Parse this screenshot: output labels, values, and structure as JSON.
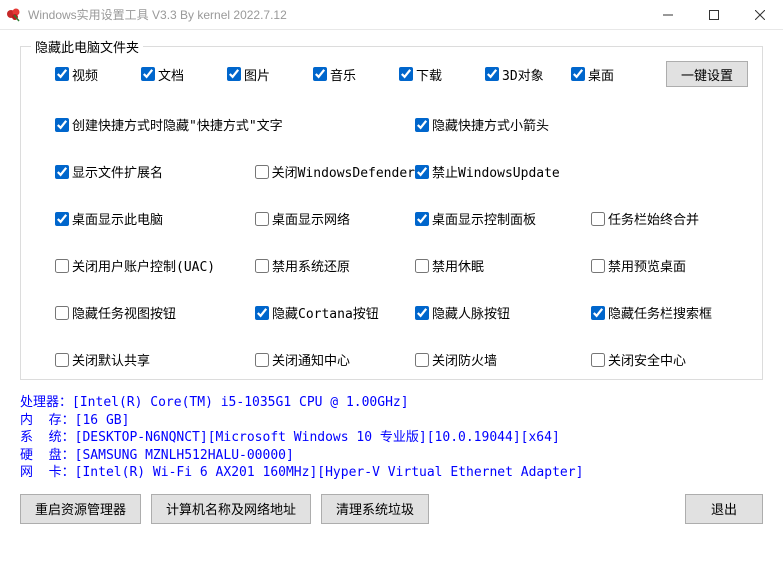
{
  "window": {
    "title": "Windows实用设置工具 V3.3 By kernel 2022.7.12"
  },
  "group": {
    "title": "隐藏此电脑文件夹",
    "folders": [
      {
        "label": "视频",
        "checked": true
      },
      {
        "label": "文档",
        "checked": true
      },
      {
        "label": "图片",
        "checked": true
      },
      {
        "label": "音乐",
        "checked": true
      },
      {
        "label": "下载",
        "checked": true
      },
      {
        "label": "3D对象",
        "checked": true
      },
      {
        "label": "桌面",
        "checked": true
      }
    ],
    "one_key": "一键设置"
  },
  "opts": [
    {
      "label": "创建快捷方式时隐藏\"快捷方式\"文字",
      "checked": true,
      "span": 2
    },
    {
      "label": "隐藏快捷方式小箭头",
      "checked": true,
      "span": 2
    },
    {
      "label": "显示文件扩展名",
      "checked": true
    },
    {
      "label": "关闭WindowsDefender",
      "checked": false
    },
    {
      "label": "禁止WindowsUpdate",
      "checked": true,
      "span": 2
    },
    {
      "label": "桌面显示此电脑",
      "checked": true
    },
    {
      "label": "桌面显示网络",
      "checked": false
    },
    {
      "label": "桌面显示控制面板",
      "checked": true
    },
    {
      "label": "任务栏始终合并",
      "checked": false
    },
    {
      "label": "关闭用户账户控制(UAC)",
      "checked": false
    },
    {
      "label": "禁用系统还原",
      "checked": false
    },
    {
      "label": "禁用休眠",
      "checked": false
    },
    {
      "label": "禁用预览桌面",
      "checked": false
    },
    {
      "label": "隐藏任务视图按钮",
      "checked": false
    },
    {
      "label": "隐藏Cortana按钮",
      "checked": true
    },
    {
      "label": "隐藏人脉按钮",
      "checked": true
    },
    {
      "label": "隐藏任务栏搜索框",
      "checked": true
    },
    {
      "label": "关闭默认共享",
      "checked": false
    },
    {
      "label": "关闭通知中心",
      "checked": false
    },
    {
      "label": "关闭防火墙",
      "checked": false
    },
    {
      "label": "关闭安全中心",
      "checked": false
    }
  ],
  "sysinfo": {
    "cpu_label": "处理器：",
    "cpu_value": "[Intel(R) Core(TM) i5-1035G1 CPU @ 1.00GHz]",
    "mem_label": "内  存：",
    "mem_value": "[16 GB]",
    "sys_label": "系  统：",
    "sys_value": "[DESKTOP-N6NQNCT][Microsoft Windows 10 专业版][10.0.19044][x64]",
    "disk_label": "硬  盘：",
    "disk_value": "[SAMSUNG MZNLH512HALU-00000]",
    "net_label": "网  卡：",
    "net_value": "[Intel(R) Wi-Fi 6 AX201 160MHz][Hyper-V Virtual Ethernet Adapter]"
  },
  "buttons": {
    "restart_explorer": "重启资源管理器",
    "computer_name": "计算机名称及网络地址",
    "clean_junk": "清理系统垃圾",
    "exit": "退出"
  }
}
